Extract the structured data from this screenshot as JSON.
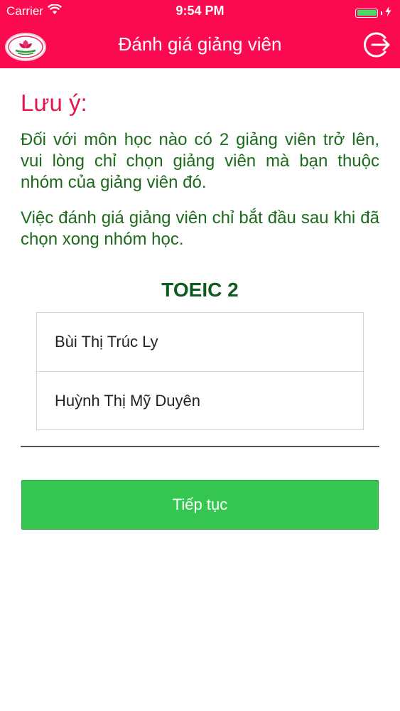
{
  "status_bar": {
    "carrier": "Carrier",
    "time": "9:54 PM",
    "wifi_icon": "wifi-icon",
    "battery_icon": "battery-icon"
  },
  "header": {
    "title": "Đánh giá giảng viên",
    "background_color": "#fb0a4f",
    "logo_icon": "university-logo-icon",
    "logout_icon": "logout-icon"
  },
  "notice": {
    "heading": "Lưu ý:",
    "paragraphs": [
      "Đối với môn học nào có 2 giảng viên trở lên, vui lòng chỉ chọn giảng viên mà bạn thuộc nhóm của giảng viên đó.",
      "Việc đánh giá giảng viên chỉ bắt đầu sau khi đã chọn xong nhóm học."
    ]
  },
  "course": {
    "name": "TOEIC 2",
    "lecturers": [
      "Bùi Thị Trúc Ly",
      "Huỳnh Thị Mỹ Duyên"
    ]
  },
  "actions": {
    "continue_label": "Tiếp tục",
    "continue_color": "#34c651"
  }
}
